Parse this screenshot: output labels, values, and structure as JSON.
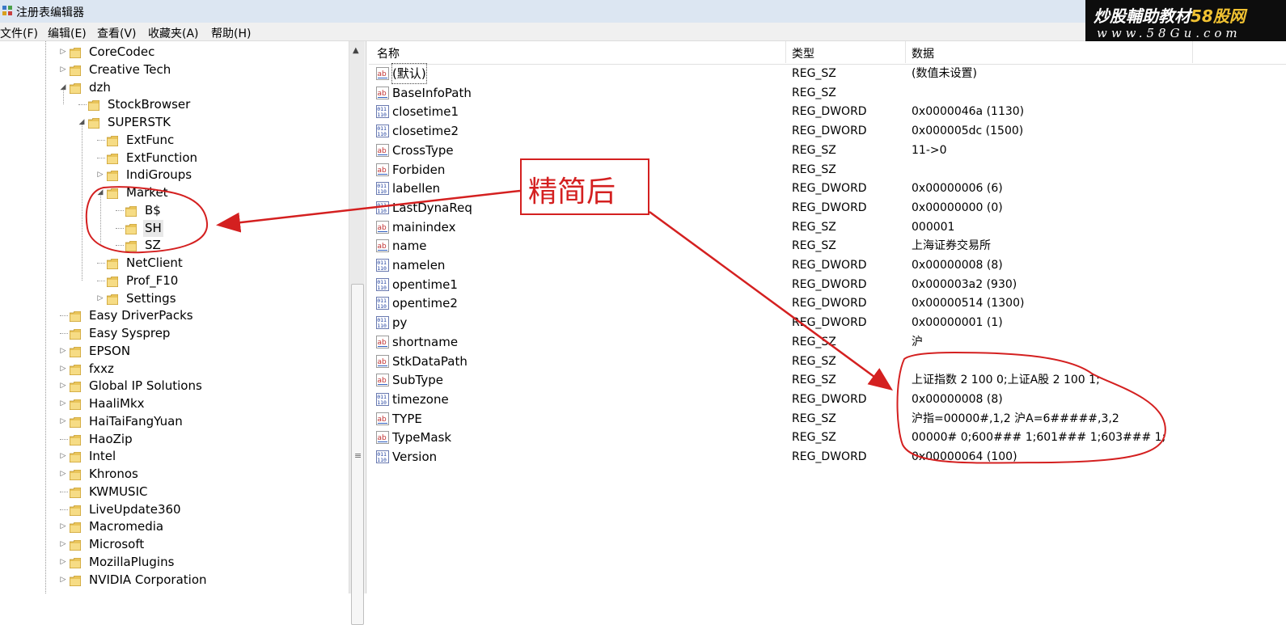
{
  "window": {
    "title": "注册表编辑器"
  },
  "menu": [
    {
      "label": "文件(F)"
    },
    {
      "label": "编辑(E)"
    },
    {
      "label": "查看(V)"
    },
    {
      "label": "收藏夹(A)"
    },
    {
      "label": "帮助(H)"
    }
  ],
  "watermark": {
    "line1": "炒股輔助教材",
    "line1_accent": "58股网",
    "line2": "www.58Gu.com"
  },
  "tree": [
    {
      "label": "CoreCodec",
      "expander": "closed",
      "level": 0
    },
    {
      "label": "Creative Tech",
      "expander": "closed",
      "level": 0
    },
    {
      "label": "dzh",
      "expander": "open",
      "level": 0
    },
    {
      "label": "StockBrowser",
      "expander": "none",
      "level": 1
    },
    {
      "label": "SUPERSTK",
      "expander": "open",
      "level": 1
    },
    {
      "label": "ExtFunc",
      "expander": "none",
      "level": 2
    },
    {
      "label": "ExtFunction",
      "expander": "none",
      "level": 2
    },
    {
      "label": "IndiGroups",
      "expander": "closed",
      "level": 2
    },
    {
      "label": "Market",
      "expander": "open",
      "level": 2
    },
    {
      "label": "B$",
      "expander": "none",
      "level": 3
    },
    {
      "label": "SH",
      "expander": "none",
      "level": 3,
      "selected": true
    },
    {
      "label": "SZ",
      "expander": "none",
      "level": 3
    },
    {
      "label": "NetClient",
      "expander": "none",
      "level": 2
    },
    {
      "label": "Prof_F10",
      "expander": "none",
      "level": 2
    },
    {
      "label": "Settings",
      "expander": "closed",
      "level": 2
    },
    {
      "label": "Easy DriverPacks",
      "expander": "none",
      "level": 0
    },
    {
      "label": "Easy Sysprep",
      "expander": "none",
      "level": 0
    },
    {
      "label": "EPSON",
      "expander": "closed",
      "level": 0
    },
    {
      "label": "fxxz",
      "expander": "closed",
      "level": 0
    },
    {
      "label": "Global IP Solutions",
      "expander": "closed",
      "level": 0
    },
    {
      "label": "HaaliMkx",
      "expander": "closed",
      "level": 0
    },
    {
      "label": "HaiTaiFangYuan",
      "expander": "closed",
      "level": 0
    },
    {
      "label": "HaoZip",
      "expander": "none",
      "level": 0
    },
    {
      "label": "Intel",
      "expander": "closed",
      "level": 0
    },
    {
      "label": "Khronos",
      "expander": "closed",
      "level": 0
    },
    {
      "label": "KWMUSIC",
      "expander": "none",
      "level": 0
    },
    {
      "label": "LiveUpdate360",
      "expander": "none",
      "level": 0
    },
    {
      "label": "Macromedia",
      "expander": "closed",
      "level": 0
    },
    {
      "label": "Microsoft",
      "expander": "closed",
      "level": 0
    },
    {
      "label": "MozillaPlugins",
      "expander": "closed",
      "level": 0
    },
    {
      "label": "NVIDIA Corporation",
      "expander": "closed",
      "level": 0
    }
  ],
  "columns": {
    "name": "名称",
    "type": "类型",
    "data": "数据"
  },
  "values": [
    {
      "name": "(默认)",
      "type": "REG_SZ",
      "data": "(数值未设置)",
      "icon": "ab"
    },
    {
      "name": "BaseInfoPath",
      "type": "REG_SZ",
      "data": "",
      "icon": "ab"
    },
    {
      "name": "closetime1",
      "type": "REG_DWORD",
      "data": "0x0000046a (1130)",
      "icon": "bin"
    },
    {
      "name": "closetime2",
      "type": "REG_DWORD",
      "data": "0x000005dc (1500)",
      "icon": "bin"
    },
    {
      "name": "CrossType",
      "type": "REG_SZ",
      "data": "11->0",
      "icon": "ab"
    },
    {
      "name": "Forbiden",
      "type": "REG_SZ",
      "data": "",
      "icon": "ab"
    },
    {
      "name": "labellen",
      "type": "REG_DWORD",
      "data": "0x00000006 (6)",
      "icon": "bin"
    },
    {
      "name": "LastDynaReq",
      "type": "REG_DWORD",
      "data": "0x00000000 (0)",
      "icon": "bin"
    },
    {
      "name": "mainindex",
      "type": "REG_SZ",
      "data": "000001",
      "icon": "ab"
    },
    {
      "name": "name",
      "type": "REG_SZ",
      "data": "上海证券交易所",
      "icon": "ab"
    },
    {
      "name": "namelen",
      "type": "REG_DWORD",
      "data": "0x00000008 (8)",
      "icon": "bin"
    },
    {
      "name": "opentime1",
      "type": "REG_DWORD",
      "data": "0x000003a2 (930)",
      "icon": "bin"
    },
    {
      "name": "opentime2",
      "type": "REG_DWORD",
      "data": "0x00000514 (1300)",
      "icon": "bin"
    },
    {
      "name": "py",
      "type": "REG_DWORD",
      "data": "0x00000001 (1)",
      "icon": "bin"
    },
    {
      "name": "shortname",
      "type": "REG_SZ",
      "data": "沪",
      "icon": "ab"
    },
    {
      "name": "StkDataPath",
      "type": "REG_SZ",
      "data": "",
      "icon": "ab"
    },
    {
      "name": "SubType",
      "type": "REG_SZ",
      "data": "上证指数 2 100 0;上证A股 2 100 1;",
      "icon": "ab"
    },
    {
      "name": "timezone",
      "type": "REG_DWORD",
      "data": "0x00000008 (8)",
      "icon": "bin"
    },
    {
      "name": "TYPE",
      "type": "REG_SZ",
      "data": "沪指=00000#,1,2 沪A=6#####,3,2",
      "icon": "ab"
    },
    {
      "name": "TypeMask",
      "type": "REG_SZ",
      "data": "00000# 0;600### 1;601### 1;603### 1;",
      "icon": "ab"
    },
    {
      "name": "Version",
      "type": "REG_DWORD",
      "data": "0x00000064 (100)",
      "icon": "bin"
    }
  ],
  "annotation": {
    "callout_text": "精简后",
    "color": "#d42020"
  }
}
